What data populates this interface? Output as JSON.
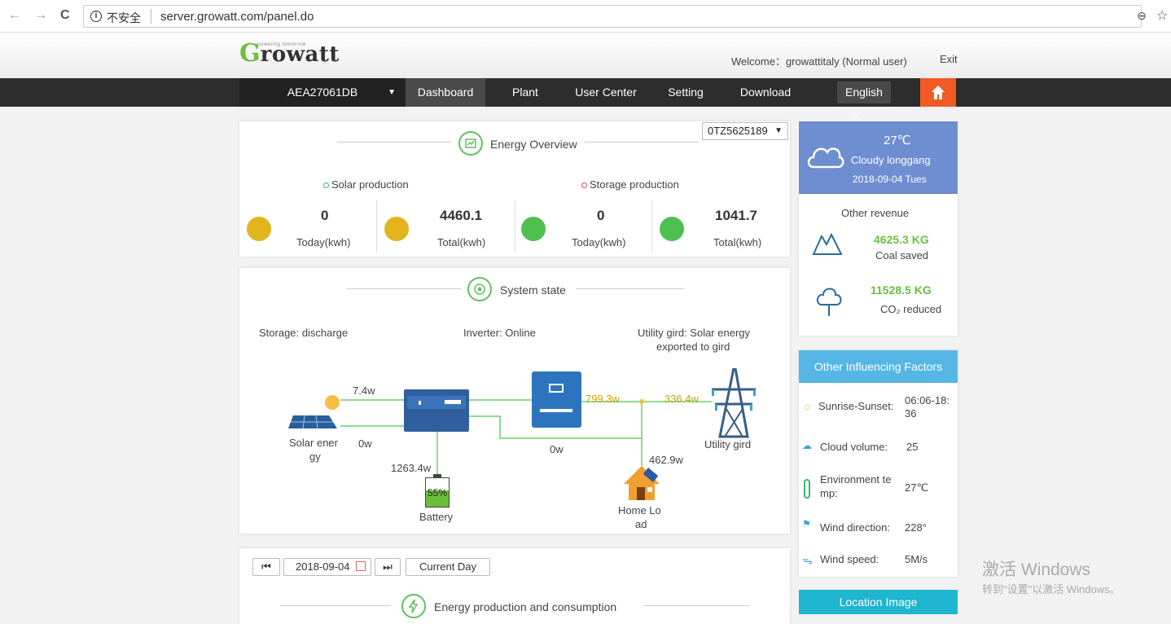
{
  "browser": {
    "back": "←",
    "forward": "→",
    "reload": "C",
    "insecure": "不安全",
    "url": "server.growatt.com/panel.do"
  },
  "header": {
    "logo_g": "G",
    "logo_rest": "rowatt",
    "logo_tag": "powering tomorrow",
    "welcome": "Welcome：growattitaly (Normal user)",
    "exit": "Exit"
  },
  "nav": {
    "device": "AEA27061DB",
    "items": [
      "Dashboard",
      "Plant",
      "User Center",
      "Setting",
      "Download"
    ],
    "language": "English"
  },
  "energy_overview": {
    "title": "Energy Overview",
    "plant": "0TZ5625189",
    "solar_legend": "Solar production",
    "storage_legend": "Storage production",
    "stats": [
      {
        "value": "0",
        "label": "Today(kwh)"
      },
      {
        "value": "4460.1",
        "label": "Total(kwh)"
      },
      {
        "value": "0",
        "label": "Today(kwh)"
      },
      {
        "value": "1041.7",
        "label": "Total(kwh)"
      }
    ]
  },
  "system_state": {
    "title": "System state",
    "storage": "Storage: discharge",
    "inverter": "Inverter: Online",
    "utility_line1": "Utility gird: Solar energy",
    "utility_line2": "exported to gird",
    "flow_solar_top": "7.4w",
    "flow_solar_bottom": "0w",
    "flow_inverter": "799.3w",
    "flow_grid": "336.4w",
    "flow_mid": "0w",
    "flow_battery": "1263.4w",
    "flow_home": "462.9w",
    "battery_pct": "55%",
    "solar_label_1": "Solar ener",
    "solar_label_2": "gy",
    "battery_label": "Battery",
    "home_label_1": "Home Lo",
    "home_label_2": "ad",
    "grid_label": "Utility gird"
  },
  "date_controls": {
    "first": "⏮",
    "date": "2018-09-04",
    "last": "⏭",
    "current": "Current Day"
  },
  "production": {
    "title": "Energy production and consumption"
  },
  "weather": {
    "temp": "27℃",
    "city": "Cloudy  longgang",
    "date": "2018-09-04 Tues"
  },
  "revenue": {
    "title": "Other revenue",
    "coal_value": "4625.3 KG",
    "coal_label": "Coal saved",
    "co2_value": "11528.5 KG",
    "co2_label": "CO₂ reduced"
  },
  "factors": {
    "title": "Other Influencing Factors",
    "sunrise_label": "Sunrise-Sunset:",
    "sunrise_value_1": "06:06-18:",
    "sunrise_value_2": "36",
    "cloud_label": "Cloud volume:",
    "cloud_value": "25",
    "env_label_1": "Environment te",
    "env_label_2": "mp:",
    "env_value": "27℃",
    "wind_dir_label": "Wind direction:",
    "wind_dir_value": "228°",
    "wind_speed_label": "Wind speed:",
    "wind_speed_value": "5M/s"
  },
  "location": {
    "title": "Location Image"
  },
  "watermark": {
    "line1": "激活 Windows",
    "line2": "转到\"设置\"以激活 Windows。"
  },
  "colors": {
    "green": "#6bbf3c",
    "nav": "#2d2d2d",
    "home": "#f15a24",
    "weather": "#6e8ed1",
    "factors": "#56b6e6",
    "location": "#20b5d1"
  }
}
